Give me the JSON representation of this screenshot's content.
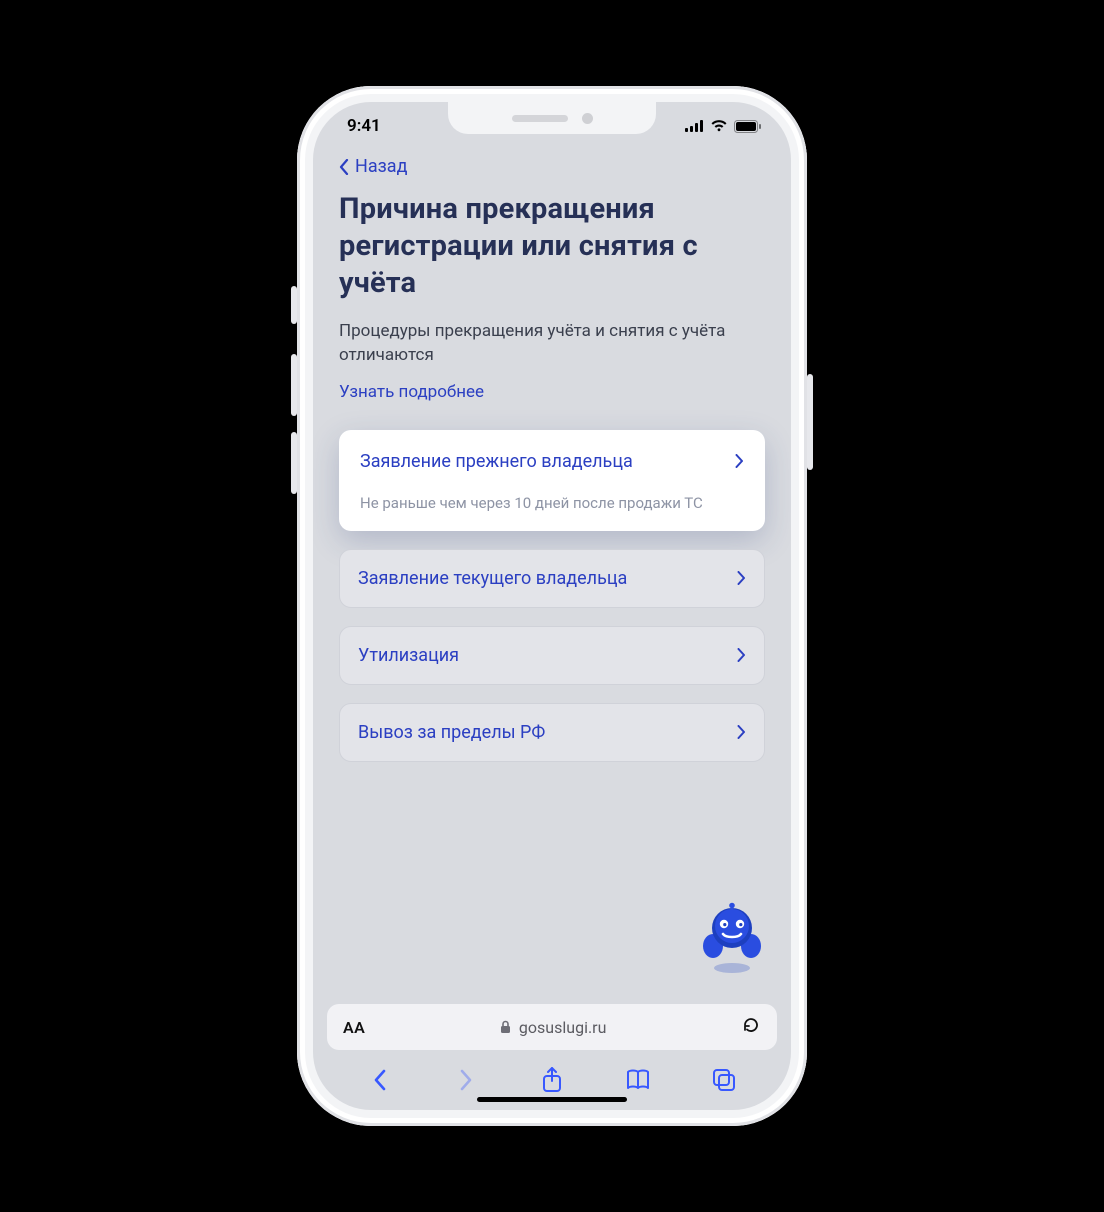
{
  "statusbar": {
    "time": "9:41"
  },
  "nav": {
    "back_label": "Назад"
  },
  "page": {
    "title": "Причина прекращения регистрации или снятия с учёта",
    "subtitle": "Процедуры прекращения учёта и снятия с учёта отличаются",
    "more_link": "Узнать подробнее"
  },
  "options": [
    {
      "label": "Заявление прежнего владельца",
      "note": "Не раньше чем через 10 дней после продажи ТС"
    },
    {
      "label": "Заявление текущего владельца"
    },
    {
      "label": "Утилизация"
    },
    {
      "label": "Вывоз за пределы РФ"
    }
  ],
  "urlbar": {
    "aa": "AA",
    "domain": "gosuslugi.ru"
  },
  "colors": {
    "link": "#2b3fc2",
    "toolbar": "#3858ff"
  }
}
